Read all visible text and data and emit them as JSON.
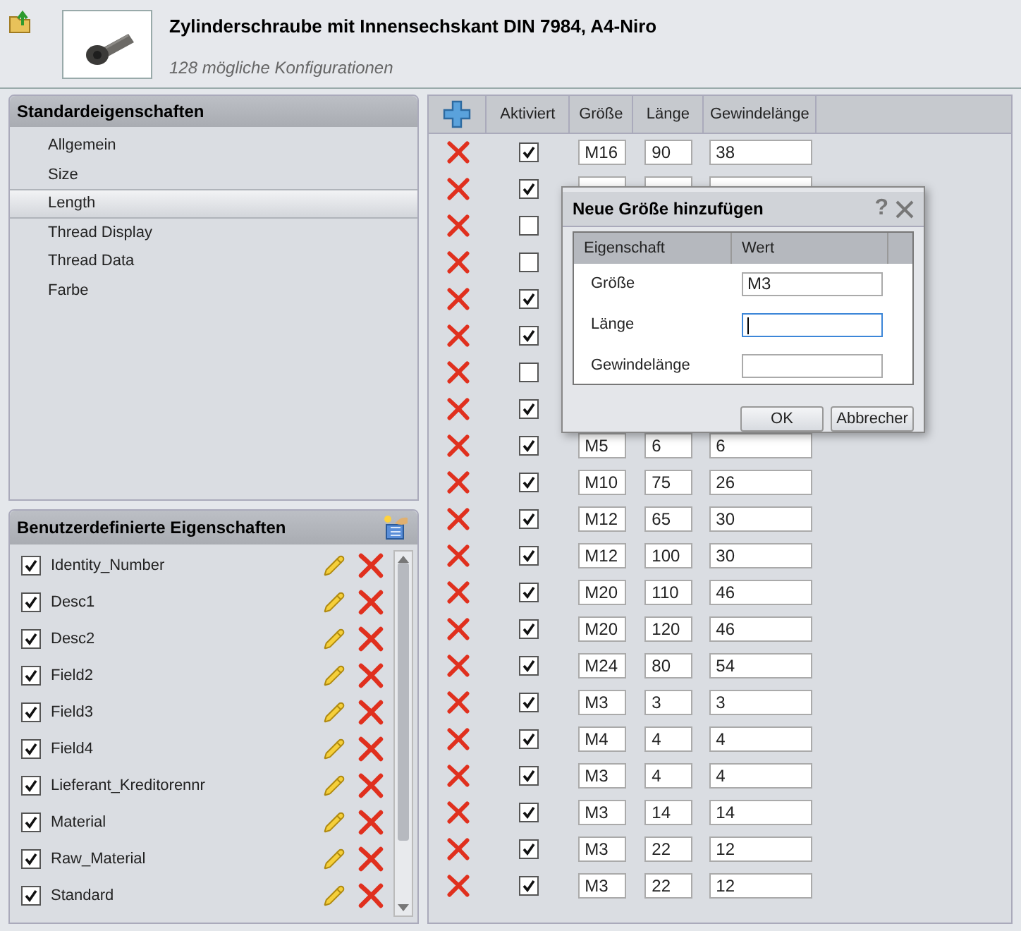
{
  "product": {
    "title": "Zylinderschraube mit Innensechskant DIN 7984, A4-Niro",
    "subtitle": "128 mögliche Konfigurationen"
  },
  "standard": {
    "title": "Standardeigenschaften",
    "items": [
      {
        "label": "Allgemein",
        "selected": false
      },
      {
        "label": "Size",
        "selected": false
      },
      {
        "label": "Length",
        "selected": true
      },
      {
        "label": "Thread Display",
        "selected": false
      },
      {
        "label": "Thread Data",
        "selected": false
      },
      {
        "label": "Farbe",
        "selected": false
      }
    ]
  },
  "custom": {
    "title": "Benutzerdefinierte Eigenschaften",
    "items": [
      {
        "label": "Identity_Number",
        "checked": true
      },
      {
        "label": "Desc1",
        "checked": true
      },
      {
        "label": "Desc2",
        "checked": true
      },
      {
        "label": "Field2",
        "checked": true
      },
      {
        "label": "Field3",
        "checked": true
      },
      {
        "label": "Field4",
        "checked": true
      },
      {
        "label": "Lieferant_Kreditorennr",
        "checked": true
      },
      {
        "label": "Material",
        "checked": true
      },
      {
        "label": "Raw_Material",
        "checked": true
      },
      {
        "label": "Standard",
        "checked": true
      }
    ]
  },
  "table": {
    "columns": [
      "Aktiviert",
      "Größe",
      "Länge",
      "Gewindelänge"
    ],
    "rows": [
      {
        "checked": true,
        "size": "M16",
        "length": "90",
        "thread": "38"
      },
      {
        "checked": true,
        "kind": "blank"
      },
      {
        "checked": false
      },
      {
        "checked": false
      },
      {
        "checked": true
      },
      {
        "checked": true
      },
      {
        "checked": false
      },
      {
        "checked": true
      },
      {
        "checked": true,
        "size": "M5",
        "length": "6",
        "thread": "6"
      },
      {
        "checked": true,
        "size": "M10",
        "length": "75",
        "thread": "26"
      },
      {
        "checked": true,
        "size": "M12",
        "length": "65",
        "thread": "30"
      },
      {
        "checked": true,
        "size": "M12",
        "length": "100",
        "thread": "30"
      },
      {
        "checked": true,
        "size": "M20",
        "length": "110",
        "thread": "46"
      },
      {
        "checked": true,
        "size": "M20",
        "length": "120",
        "thread": "46"
      },
      {
        "checked": true,
        "size": "M24",
        "length": "80",
        "thread": "54"
      },
      {
        "checked": true,
        "size": "M3",
        "length": "3",
        "thread": "3"
      },
      {
        "checked": true,
        "size": "M4",
        "length": "4",
        "thread": "4"
      },
      {
        "checked": true,
        "size": "M3",
        "length": "4",
        "thread": "4"
      },
      {
        "checked": true,
        "size": "M3",
        "length": "14",
        "thread": "14"
      },
      {
        "checked": true,
        "size": "M3",
        "length": "22",
        "thread": "12"
      },
      {
        "checked": true,
        "size": "M3",
        "length": "22",
        "thread": "12"
      }
    ]
  },
  "dialog": {
    "title": "Neue Größe hinzufügen",
    "help": "?",
    "columns": [
      "Eigenschaft",
      "Wert"
    ],
    "fields": [
      {
        "label": "Größe",
        "value": "M3",
        "focused": false
      },
      {
        "label": "Länge",
        "focused": true
      },
      {
        "label": "Gewindelänge",
        "focused": false
      }
    ],
    "buttons": [
      "OK",
      "Abbrecher"
    ]
  }
}
